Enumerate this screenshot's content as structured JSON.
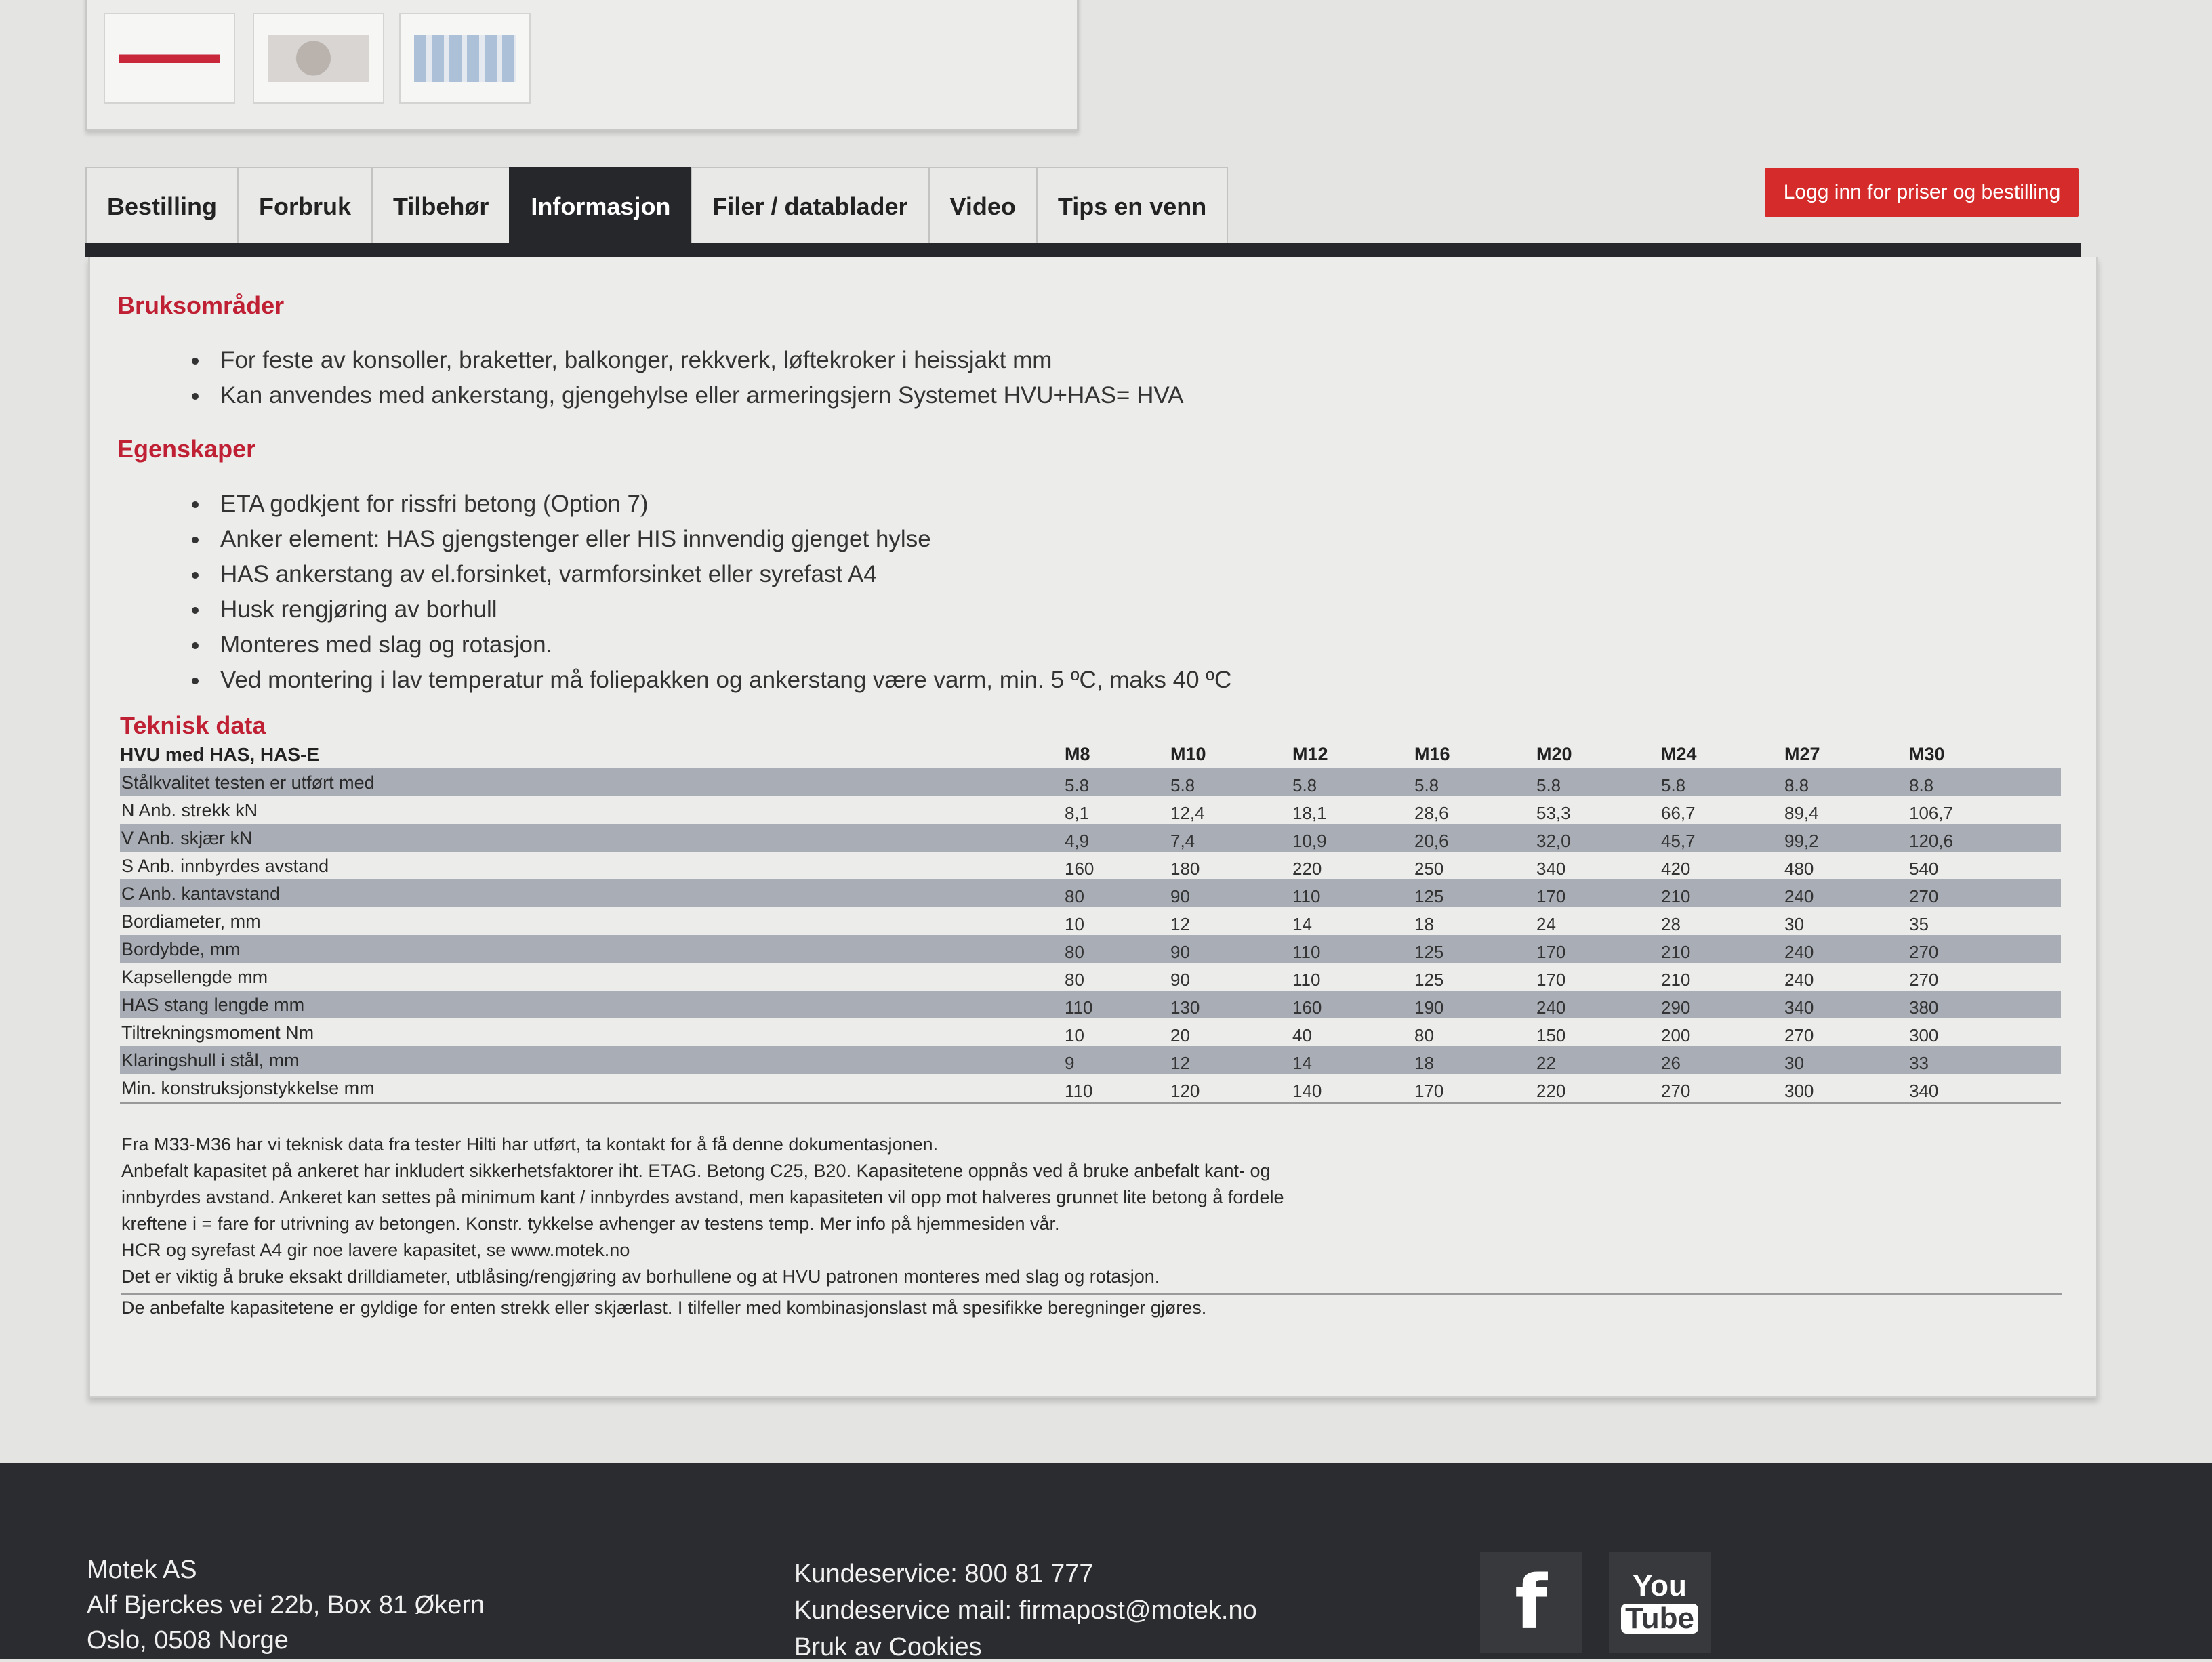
{
  "tabs": [
    "Bestilling",
    "Forbruk",
    "Tilbehør",
    "Informasjon",
    "Filer / datablader",
    "Video",
    "Tips en venn"
  ],
  "active_tab": "Informasjon",
  "login_button": "Logg inn for priser og bestilling",
  "sections": {
    "bruksomrader": {
      "title": "Bruksområder",
      "items": [
        "For feste av konsoller, braketter, balkonger, rekkverk, løftekroker i heissjakt mm",
        "Kan anvendes med ankerstang, gjengehylse eller armeringsjern Systemet HVU+HAS= HVA"
      ]
    },
    "egenskaper": {
      "title": "Egenskaper",
      "items": [
        "ETA godkjent for rissfri betong (Option 7)",
        "Anker element: HAS gjengstenger eller HIS innvendig gjenget hylse",
        "HAS ankerstang av el.forsinket, varmforsinket eller syrefast A4",
        "Husk rengjøring av borhull",
        "Monteres med slag og rotasjon.",
        "Ved montering i lav temperatur må foliepakken og ankerstang være varm, min. 5 ºC, maks 40 ºC"
      ]
    }
  },
  "tech": {
    "title": "Teknisk data",
    "header_label": "HVU med HAS, HAS-E",
    "columns": [
      "M8",
      "M10",
      "M12",
      "M16",
      "M20",
      "M24",
      "M27",
      "M30"
    ],
    "rows": [
      {
        "label": "Stålkvalitet testen er utført med",
        "values": [
          "5.8",
          "5.8",
          "5.8",
          "5.8",
          "5.8",
          "5.8",
          "8.8",
          "8.8"
        ]
      },
      {
        "label": "N Anb. strekk kN",
        "values": [
          "8,1",
          "12,4",
          "18,1",
          "28,6",
          "53,3",
          "66,7",
          "89,4",
          "106,7"
        ]
      },
      {
        "label": "V Anb. skjær kN",
        "values": [
          "4,9",
          "7,4",
          "10,9",
          "20,6",
          "32,0",
          "45,7",
          "99,2",
          "120,6"
        ]
      },
      {
        "label": "S Anb. innbyrdes avstand",
        "values": [
          "160",
          "180",
          "220",
          "250",
          "340",
          "420",
          "480",
          "540"
        ]
      },
      {
        "label": "C Anb. kantavstand",
        "values": [
          "80",
          "90",
          "110",
          "125",
          "170",
          "210",
          "240",
          "270"
        ]
      },
      {
        "label": "Bordiameter, mm",
        "values": [
          "10",
          "12",
          "14",
          "18",
          "24",
          "28",
          "30",
          "35"
        ]
      },
      {
        "label": "Bordybde, mm",
        "values": [
          "80",
          "90",
          "110",
          "125",
          "170",
          "210",
          "240",
          "270"
        ]
      },
      {
        "label": "Kapsellengde mm",
        "values": [
          "80",
          "90",
          "110",
          "125",
          "170",
          "210",
          "240",
          "270"
        ]
      },
      {
        "label": "HAS stang lengde mm",
        "values": [
          "110",
          "130",
          "160",
          "190",
          "240",
          "290",
          "340",
          "380"
        ]
      },
      {
        "label": "Tiltrekningsmoment Nm",
        "values": [
          "10",
          "20",
          "40",
          "80",
          "150",
          "200",
          "270",
          "300"
        ]
      },
      {
        "label": "Klaringshull i stål, mm",
        "values": [
          "9",
          "12",
          "14",
          "18",
          "22",
          "26",
          "30",
          "33"
        ]
      },
      {
        "label": "Min. konstruksjonstykkelse mm",
        "values": [
          "110",
          "120",
          "140",
          "170",
          "220",
          "270",
          "300",
          "340"
        ]
      }
    ],
    "notes": [
      "Fra M33-M36 har vi teknisk data fra tester Hilti har utført, ta kontakt for å få denne dokumentasjonen.",
      "Anbefalt kapasitet på ankeret har inkludert sikkerhetsfaktorer iht. ETAG. Betong C25, B20. Kapasitetene oppnås ved å bruke anbefalt kant- og",
      "innbyrdes avstand. Ankeret kan settes på minimum kant / innbyrdes avstand, men kapasiteten vil opp mot halveres grunnet lite betong å fordele",
      "kreftene i = fare for utrivning av betongen. Konstr. tykkelse avhenger av testens temp. Mer info på hjemmesiden vår.",
      "HCR og syrefast A4 gir noe lavere kapasitet, se www.motek.no",
      "Det er viktig å bruke eksakt drilldiameter, utblåsing/rengjøring av borhullene og at HVU patronen monteres med slag og rotasjon.",
      "De anbefalte kapasitetene er gyldige for enten strekk eller skjærlast. I tilfeller med kombinasjonslast må spesifikke beregninger gjøres."
    ]
  },
  "footer": {
    "company": "Motek AS",
    "address1": "Alf Bjerckes vei 22b, Box 81 Økern",
    "address2": "Oslo, 0508 Norge",
    "kundeservice": "Kundeservice: 800 81 777",
    "mail": "Kundeservice mail: firmapost@motek.no",
    "cookies": "Bruk av Cookies"
  },
  "social": {
    "facebook_glyph": "f",
    "youtube_top": "You",
    "youtube_bottom": "Tube"
  },
  "colors": {
    "accent_red": "#c02034",
    "button_red": "#d52b2b",
    "dark": "#26272a",
    "row_shade": "#a9adb5"
  }
}
